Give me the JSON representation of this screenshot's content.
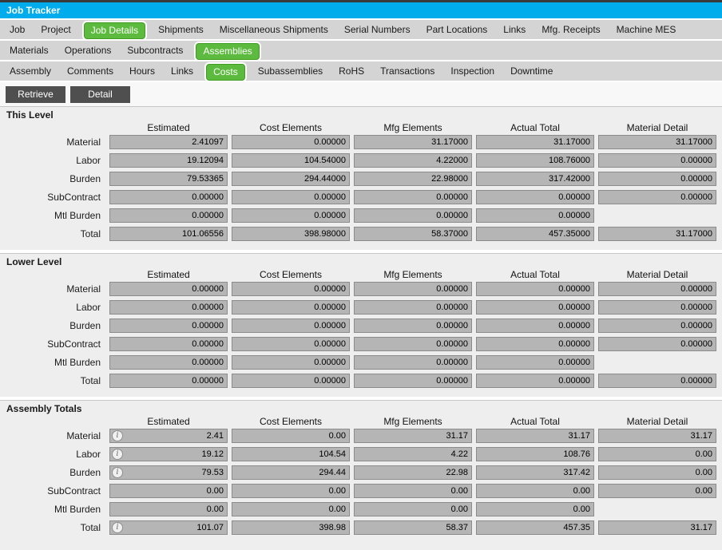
{
  "window": {
    "title": "Job Tracker"
  },
  "tabs": {
    "row1": {
      "items": [
        "Job",
        "Project",
        "Job Details",
        "Shipments",
        "Miscellaneous Shipments",
        "Serial Numbers",
        "Part Locations",
        "Links",
        "Mfg. Receipts",
        "Machine MES"
      ],
      "selected": "Job Details"
    },
    "row2": {
      "items": [
        "Materials",
        "Operations",
        "Subcontracts",
        "Assemblies"
      ],
      "selected": "Assemblies"
    },
    "row3": {
      "items": [
        "Assembly",
        "Comments",
        "Hours",
        "Links",
        "Costs",
        "Subassemblies",
        "RoHS",
        "Transactions",
        "Inspection",
        "Downtime"
      ],
      "selected": "Costs"
    }
  },
  "toolbar": {
    "retrieve_label": "Retrieve",
    "detail_label": "Detail"
  },
  "columns": [
    "Estimated",
    "Cost Elements",
    "Mfg Elements",
    "Actual Total",
    "Material Detail"
  ],
  "sections": [
    {
      "title": "This Level",
      "rows": [
        {
          "label": "Material",
          "info": false,
          "total": false,
          "values": [
            "2.41097",
            "0.00000",
            "31.17000",
            "31.17000",
            "31.17000"
          ]
        },
        {
          "label": "Labor",
          "info": false,
          "total": false,
          "values": [
            "19.12094",
            "104.54000",
            "4.22000",
            "108.76000",
            "0.00000"
          ]
        },
        {
          "label": "Burden",
          "info": false,
          "total": false,
          "values": [
            "79.53365",
            "294.44000",
            "22.98000",
            "317.42000",
            "0.00000"
          ]
        },
        {
          "label": "SubContract",
          "info": false,
          "total": false,
          "values": [
            "0.00000",
            "0.00000",
            "0.00000",
            "0.00000",
            "0.00000"
          ]
        },
        {
          "label": "Mtl Burden",
          "info": false,
          "total": false,
          "values": [
            "0.00000",
            "0.00000",
            "0.00000",
            "0.00000",
            null
          ]
        },
        {
          "label": "Total",
          "info": false,
          "total": true,
          "values": [
            "101.06556",
            "398.98000",
            "58.37000",
            "457.35000",
            "31.17000"
          ]
        }
      ]
    },
    {
      "title": "Lower Level",
      "rows": [
        {
          "label": "Material",
          "info": false,
          "total": false,
          "values": [
            "0.00000",
            "0.00000",
            "0.00000",
            "0.00000",
            "0.00000"
          ]
        },
        {
          "label": "Labor",
          "info": false,
          "total": false,
          "values": [
            "0.00000",
            "0.00000",
            "0.00000",
            "0.00000",
            "0.00000"
          ]
        },
        {
          "label": "Burden",
          "info": false,
          "total": false,
          "values": [
            "0.00000",
            "0.00000",
            "0.00000",
            "0.00000",
            "0.00000"
          ]
        },
        {
          "label": "SubContract",
          "info": false,
          "total": false,
          "values": [
            "0.00000",
            "0.00000",
            "0.00000",
            "0.00000",
            "0.00000"
          ]
        },
        {
          "label": "Mtl Burden",
          "info": false,
          "total": false,
          "values": [
            "0.00000",
            "0.00000",
            "0.00000",
            "0.00000",
            null
          ]
        },
        {
          "label": "Total",
          "info": false,
          "total": true,
          "values": [
            "0.00000",
            "0.00000",
            "0.00000",
            "0.00000",
            "0.00000"
          ]
        }
      ]
    },
    {
      "title": "Assembly Totals",
      "rows": [
        {
          "label": "Material",
          "info": true,
          "total": false,
          "values": [
            "2.41",
            "0.00",
            "31.17",
            "31.17",
            "31.17"
          ]
        },
        {
          "label": "Labor",
          "info": true,
          "total": false,
          "values": [
            "19.12",
            "104.54",
            "4.22",
            "108.76",
            "0.00"
          ]
        },
        {
          "label": "Burden",
          "info": true,
          "total": false,
          "values": [
            "79.53",
            "294.44",
            "22.98",
            "317.42",
            "0.00"
          ]
        },
        {
          "label": "SubContract",
          "info": false,
          "total": false,
          "values": [
            "0.00",
            "0.00",
            "0.00",
            "0.00",
            "0.00"
          ]
        },
        {
          "label": "Mtl Burden",
          "info": false,
          "total": false,
          "values": [
            "0.00",
            "0.00",
            "0.00",
            "0.00",
            null
          ]
        },
        {
          "label": "Total",
          "info": true,
          "total": true,
          "values": [
            "101.07",
            "398.98",
            "58.37",
            "457.35",
            "31.17"
          ]
        }
      ]
    }
  ],
  "icons": {
    "info": "info-icon"
  },
  "colors": {
    "titlebar_cyan": "#00acec",
    "selected_tab_green": "#5cbb3e",
    "selected_tab_border": "#3f9d24",
    "tab_row_gray": "#d4d4d4",
    "button_gray": "#4f4f4f",
    "field_gray": "#b5b5b5",
    "field_border": "#8b8b8b",
    "section_bg": "#eeeeee",
    "top_strip": "#3a3a3a"
  }
}
